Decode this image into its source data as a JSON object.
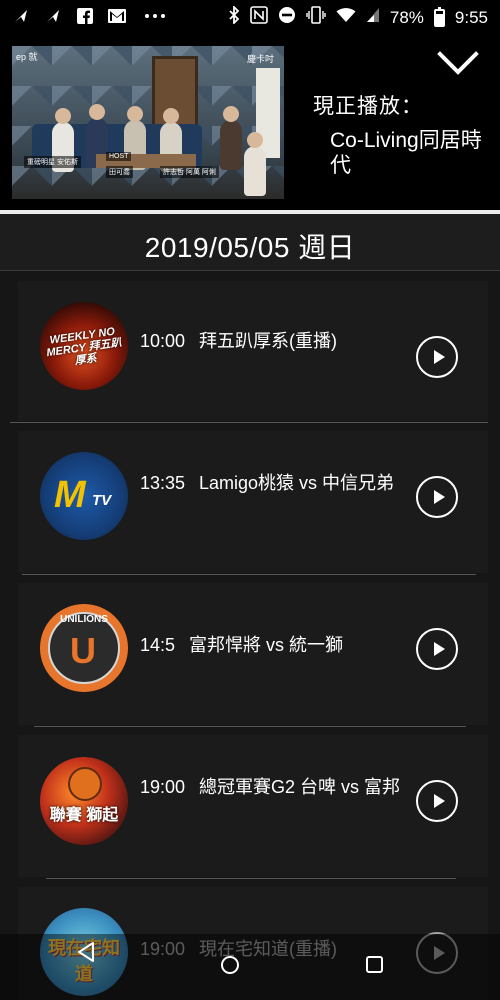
{
  "status_bar": {
    "left_icons": [
      "send-icon",
      "send-icon",
      "facebook-icon",
      "gmail-icon",
      "more-icon"
    ],
    "right_icons": [
      "bluetooth-icon",
      "nfc-icon",
      "do-not-disturb-icon",
      "vibrate-icon",
      "wifi-icon",
      "signal-icon"
    ],
    "battery": "78%",
    "time": "9:55"
  },
  "now_playing": {
    "label": "現正播放：",
    "title": "Co-Living同居時代",
    "video_captions": {
      "logo_left": "ep 就",
      "logo_right": "慶卡吋",
      "guest": "重磅明星 安佑斯",
      "host_label": "HOST",
      "host1": "田可喬",
      "host2": "許志哲 阿萬 阿俐"
    },
    "collapse_icon": "chevron-down-icon"
  },
  "date": "2019/05/05 週日",
  "schedule": [
    {
      "time": "10:00",
      "title": "拜五趴厚系(重播)",
      "thumb_text": "WEEKLY NO MERCY 拜五趴厚系"
    },
    {
      "time": "13:35",
      "title": "Lamigo桃猿 vs 中信兄弟",
      "thumb_text_m": "M",
      "thumb_text_tv": "TV"
    },
    {
      "time": "14:5",
      "title": "富邦悍將 vs 統一獅",
      "thumb_text_u": "UNILIONS",
      "thumb_text_j": "U"
    },
    {
      "time": "19:00",
      "title": "總冠軍賽G2 台啤 vs 富邦",
      "thumb_text": "聯賽 獅起"
    },
    {
      "time": "19:00",
      "title": "現在宅知道(重播)",
      "thumb_text": "現在宅知道"
    }
  ],
  "nav_bar": {
    "back_icon": "back-icon",
    "home_icon": "home-icon",
    "recents_icon": "recents-icon"
  }
}
